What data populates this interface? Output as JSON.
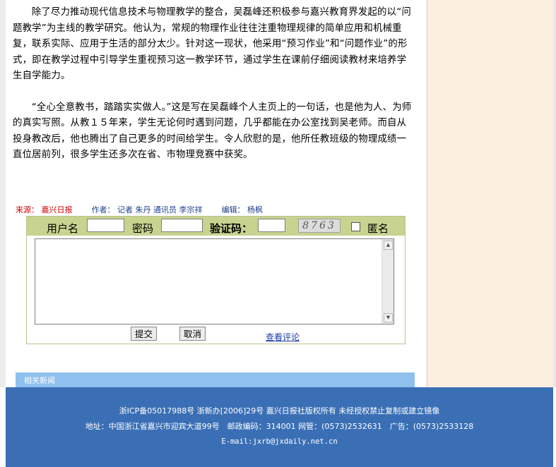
{
  "article": {
    "paragraphs": [
      "除了尽力推动现代信息技术与物理教学的整合，吴磊峰还积极参与嘉兴教育界发起的以“问题教学”为主线的教学研究。他认为，常规的物理作业往往注重物理规律的简单应用和机械重复，联系实际、应用于生活的部分太少。针对这一现状，他采用“预习作业”和“问题作业”的形式，即在教学过程中引导学生重视预习这一教学环节，通过学生在课前仔细阅读教材来培养学生自学能力。",
      "“全心全意教书，踏踏实实做人。”这是写在吴磊峰个人主页上的一句话，也是他为人、为师的真实写照。从教１５年来，学生无论何时遇到问题，几乎都能在办公室找到吴老师。而自从投身教改后，他也腾出了自己更多的时间给学生。令人欣慰的是，他所任教班级的物理成绩一直位居前列，很多学生还多次在省、市物理竞赛中获奖。"
    ]
  },
  "meta": {
    "source_label": "来源：",
    "source_value": "嘉兴日报",
    "author_label": "作者：",
    "author_value": "记者 朱丹 通讯员 李宗祥",
    "editor_label": "编辑：",
    "editor_value": "杨枫"
  },
  "comment_form": {
    "username_label": "用户名",
    "username_value": "",
    "password_label": "密码",
    "password_value": "",
    "captcha_label": "验证码：",
    "captcha_value": "",
    "captcha_text": "8763",
    "anonymous_label": "匿名",
    "anonymous_checked": false,
    "comment_text": "",
    "submit_label": "提交",
    "cancel_label": "取消",
    "view_comments_label": "查看评论"
  },
  "related": {
    "title": "相关新闻"
  },
  "footer": {
    "line1": "浙ICP备05017988号 浙新办[2006]29号 嘉兴日报社版权所有 未经授权禁止复制或建立镜像",
    "line2": "地址：中国浙江省嘉兴市迎宾大道99号　邮政编码：314001 网管：(0573)2532631　广告：(0573)2533128",
    "line3": "E-mail:jxrb@jxdaily.net.cn"
  },
  "colors": {
    "footer_bg": "#3a6fb5",
    "related_bar": "#8fc0ee",
    "form_bar": "#c7d38f",
    "right_panel": "#fbeede",
    "source_red": "#cc0000",
    "meta_blue": "#1f3f8a"
  }
}
